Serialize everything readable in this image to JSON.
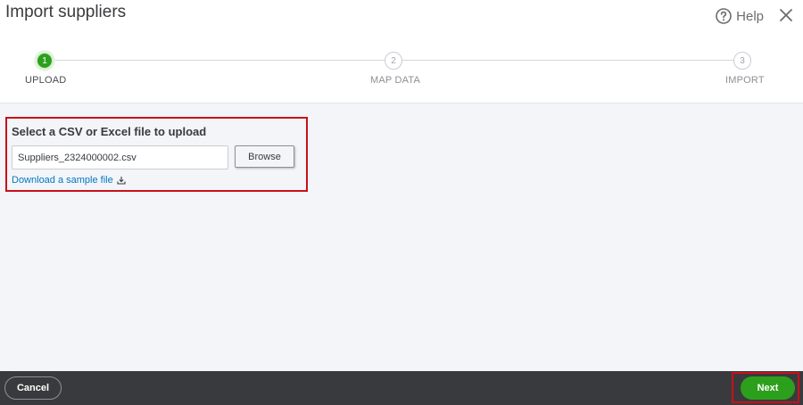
{
  "header": {
    "title": "Import suppliers",
    "help_label": "Help",
    "help_icon": "question-circle-icon",
    "close_icon": "close-icon"
  },
  "stepper": {
    "steps": [
      {
        "number": "1",
        "label": "UPLOAD",
        "active": true
      },
      {
        "number": "2",
        "label": "MAP DATA",
        "active": false
      },
      {
        "number": "3",
        "label": "IMPORT",
        "active": false
      }
    ],
    "active_color": "#2ca01c"
  },
  "upload": {
    "heading": "Select a CSV or Excel file to upload",
    "file_value": "Suppliers_2324000002.csv",
    "browse_label": "Browse",
    "sample_link": "Download a sample file",
    "sample_icon": "download-icon"
  },
  "footer": {
    "cancel_label": "Cancel",
    "next_label": "Next"
  },
  "colors": {
    "highlight": "#c8101a",
    "primary_green": "#2ca01c",
    "link_blue": "#0077c5",
    "footer_bg": "#393a3d"
  }
}
